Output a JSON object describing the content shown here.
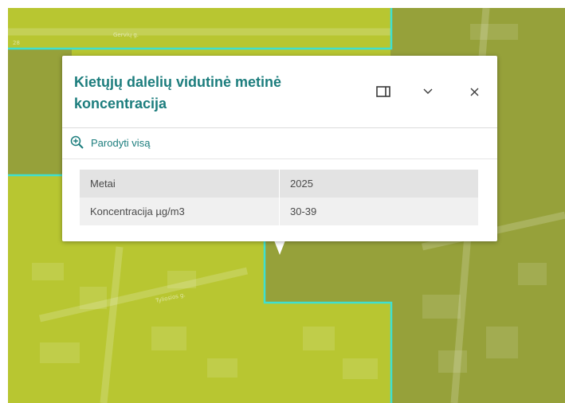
{
  "map": {
    "street_labels": [
      "Gervių g.",
      "Tyliosios g.",
      "28"
    ],
    "colors": {
      "light_zone": "#b8c631",
      "dark_zone": "#96a13a",
      "boundary": "#3fe0d0"
    }
  },
  "popup": {
    "title": "Kietųjų dalelių vidutinė metinė koncentracija",
    "dock_icon": "dock-panel-icon",
    "collapse_icon": "chevron-down-icon",
    "close_icon": "close-icon",
    "zoom_action_label": "Parodyti visą",
    "zoom_icon": "zoom-in-icon",
    "attributes": [
      {
        "field": "Metai",
        "value": "2025"
      },
      {
        "field": "Koncentracija µg/m3",
        "value": "30-39"
      }
    ]
  }
}
